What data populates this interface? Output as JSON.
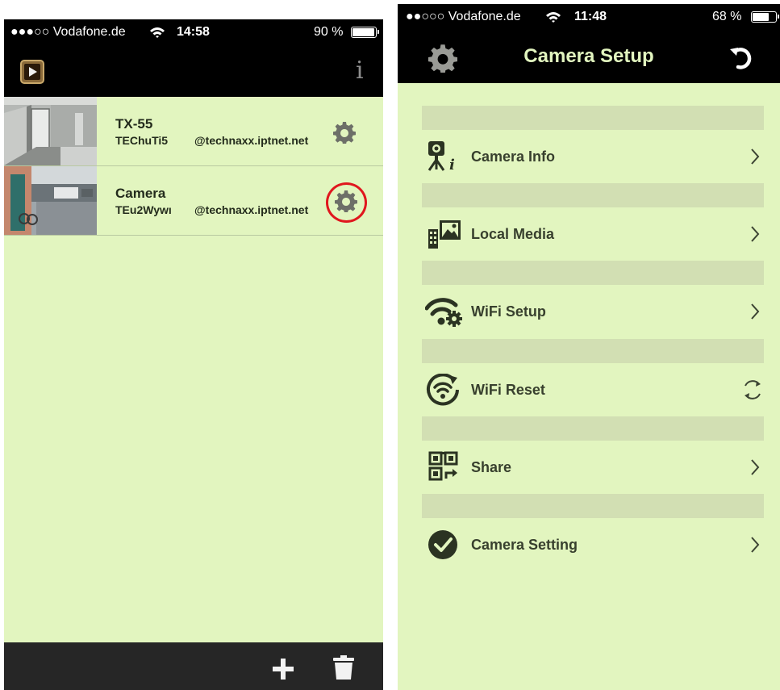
{
  "left": {
    "status_bar": {
      "carrier": "●●●○○ Vodafone.de",
      "time": "14:58",
      "battery": "90 %",
      "battery_level": 0.9
    },
    "info_label": "i",
    "devices": [
      {
        "name": "TX-55",
        "uid": "TEChuTi5",
        "host": "@technaxx.iptnet.net"
      },
      {
        "name": "Camera",
        "uid": "TEu2Wywı",
        "host": "@technaxx.iptnet.net"
      }
    ]
  },
  "right": {
    "status_bar": {
      "carrier": "●●○○○ Vodafone.de",
      "time": "11:48",
      "battery": "68 %",
      "battery_level": 0.68
    },
    "title": "Camera Setup",
    "menu": [
      {
        "label": "Camera Info",
        "icon": "camera-info-icon"
      },
      {
        "label": "Local Media",
        "icon": "local-media-icon"
      },
      {
        "label": "WiFi Setup",
        "icon": "wifi-setup-icon"
      },
      {
        "label": "WiFi Reset",
        "icon": "wifi-reset-icon"
      },
      {
        "label": "Share",
        "icon": "qr-share-icon"
      },
      {
        "label": "Camera Setting",
        "icon": "check-circle-icon"
      }
    ]
  },
  "colors": {
    "background": "#e2f5bf",
    "bar": "#000000",
    "separator": "#d2dfb3",
    "text": "#38402e",
    "highlight": "#e0171e",
    "bottom_bar": "#262626"
  }
}
